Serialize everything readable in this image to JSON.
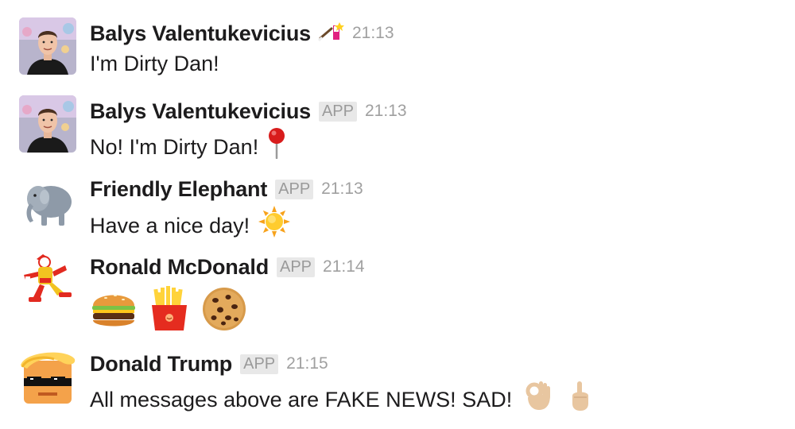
{
  "messages": [
    {
      "sender": "Balys Valentukevicius",
      "status_emoji": "magic-wand-icon",
      "app_badge": "",
      "time": "21:13",
      "text": "I'm Dirty Dan!",
      "emojis": []
    },
    {
      "sender": "Balys Valentukevicius",
      "app_badge": "APP",
      "time": "21:13",
      "text": "No! I'm Dirty Dan!",
      "emojis": [
        "round-pushpin-icon"
      ]
    },
    {
      "sender": "Friendly Elephant",
      "app_badge": "APP",
      "time": "21:13",
      "text": "Have a nice day!",
      "emojis": [
        "sun-icon"
      ]
    },
    {
      "sender": "Ronald McDonald",
      "app_badge": "APP",
      "time": "21:14",
      "text": "",
      "emojis": [
        "hamburger-icon",
        "fries-icon",
        "cookie-icon"
      ]
    },
    {
      "sender": "Donald Trump",
      "app_badge": "APP",
      "time": "21:15",
      "text": "All messages above are FAKE NEWS! SAD!",
      "emojis": [
        "ok-hand-icon",
        "point-up-icon"
      ]
    }
  ],
  "colors": {
    "sender": "#1d1c1d",
    "timestamp": "#a0a0a0",
    "app_badge_bg": "#e8e8e8",
    "app_badge_text": "#9a9a9a"
  }
}
